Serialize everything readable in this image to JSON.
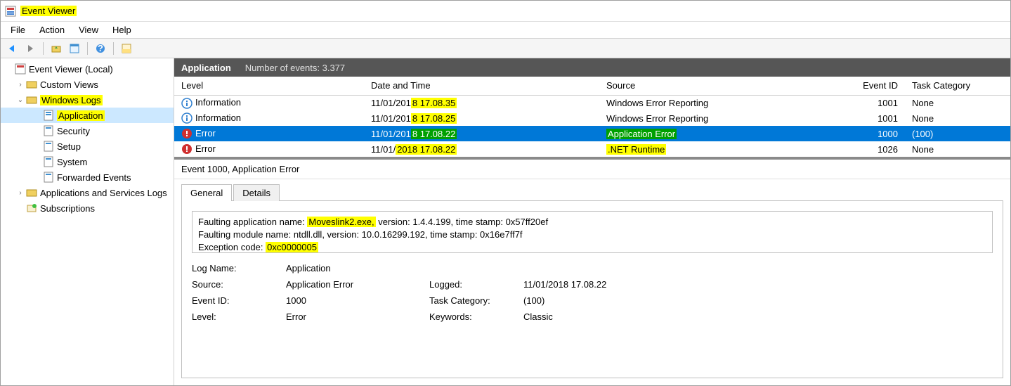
{
  "title": "Event Viewer",
  "menubar": [
    "File",
    "Action",
    "View",
    "Help"
  ],
  "tree": {
    "root": "Event Viewer (Local)",
    "custom_views": "Custom Views",
    "windows_logs": "Windows Logs",
    "app": "Application",
    "security": "Security",
    "setup": "Setup",
    "system": "System",
    "forwarded": "Forwarded Events",
    "apps_services": "Applications and Services Logs",
    "subscriptions": "Subscriptions"
  },
  "header": {
    "title": "Application",
    "count": "Number of events: 3.377"
  },
  "columns": {
    "level": "Level",
    "date": "Date and Time",
    "source": "Source",
    "id": "Event ID",
    "cat": "Task Category"
  },
  "rows": [
    {
      "level": "Information",
      "date_pre": "11/01/201",
      "date_hl": "8 17.08.35",
      "source": "Windows Error Reporting",
      "source_hl": false,
      "id": "1001",
      "cat": "None",
      "icon": "info",
      "selected": false
    },
    {
      "level": "Information",
      "date_pre": "11/01/201",
      "date_hl": "8 17.08.25",
      "source": "Windows Error Reporting",
      "source_hl": false,
      "id": "1001",
      "cat": "None",
      "icon": "info",
      "selected": false
    },
    {
      "level": "Error",
      "date_pre": "11/01/201",
      "date_hl": "8 17.08.22",
      "source": "Application Error",
      "source_hl": "green",
      "id": "1000",
      "cat": "(100)",
      "icon": "error",
      "selected": true
    },
    {
      "level": "Error",
      "date_pre": "11/01/",
      "date_hl": "2018 17.08.22",
      "source": ".NET Runtime",
      "source_hl": "yellow",
      "id": "1026",
      "cat": "None",
      "icon": "error",
      "selected": false
    }
  ],
  "detail": {
    "title": "Event 1000, Application Error",
    "tabs": {
      "general": "General",
      "details": "Details"
    },
    "desc_l1_pre": "Faulting application name: ",
    "desc_l1_hl": "Moveslink2.exe,",
    "desc_l1_post": " version: 1.4.4.199, time stamp: 0x57ff20ef",
    "desc_l2": "Faulting module name: ntdll.dll, version: 10.0.16299.192, time stamp: 0x16e7ff7f",
    "desc_l3_pre": "Exception code: ",
    "desc_l3_hl": "0xc0000005",
    "kv": {
      "log_name_k": "Log Name:",
      "log_name_v": "Application",
      "source_k": "Source:",
      "source_v": "Application Error",
      "logged_k": "Logged:",
      "logged_v": "11/01/2018 17.08.22",
      "event_id_k": "Event ID:",
      "event_id_v": "1000",
      "task_cat_k": "Task Category:",
      "task_cat_v": "(100)",
      "level_k": "Level:",
      "level_v": "Error",
      "keywords_k": "Keywords:",
      "keywords_v": "Classic"
    }
  }
}
